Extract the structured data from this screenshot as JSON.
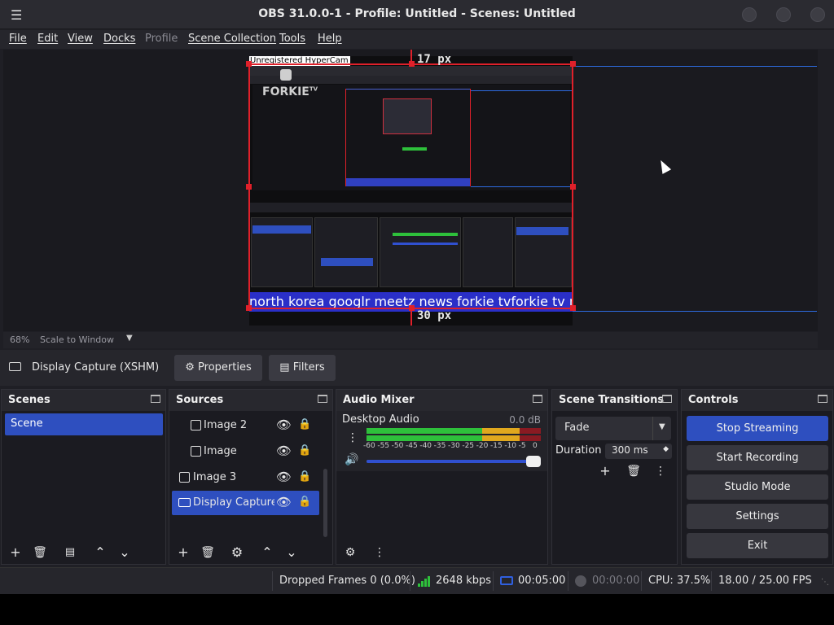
{
  "window": {
    "title": "OBS 31.0.0-1 - Profile: Untitled - Scenes: Untitled"
  },
  "menu": {
    "file": "File",
    "edit": "Edit",
    "view": "View",
    "docks": "Docks",
    "profile": "Profile",
    "scene_collection": "Scene Collection",
    "tools": "Tools",
    "help": "Help"
  },
  "preview": {
    "top_px_label": "17 px",
    "bottom_px_label": "30 px",
    "source_top_text": "Unregistered HyperCam 2",
    "logo_text": "FORKIE",
    "logo_sup": "TV",
    "ticker_text": "north korea googlr meetz news forkie tvforkie tv news br"
  },
  "zoom": {
    "percent": "68%",
    "mode": "Scale to Window"
  },
  "source_toolbar": {
    "selected_source": "Display Capture (XSHM)",
    "properties_label": "Properties",
    "filters_label": "Filters"
  },
  "scenes": {
    "title": "Scenes",
    "items": [
      "Scene"
    ]
  },
  "sources": {
    "title": "Sources",
    "items": [
      {
        "name": "Image 2",
        "icon": "image-icon"
      },
      {
        "name": "Image",
        "icon": "image-icon"
      },
      {
        "name": "Image 3",
        "icon": "image-icon"
      },
      {
        "name": "Display Capture (",
        "icon": "monitor-icon"
      }
    ]
  },
  "mixer": {
    "title": "Audio Mixer",
    "channel": "Desktop Audio",
    "level": "0.0 dB",
    "scale": [
      "-60",
      "-55",
      "-50",
      "-45",
      "-40",
      "-35",
      "-30",
      "-25",
      "-20",
      "-15",
      "-10",
      "-5",
      "0"
    ],
    "volume_fraction": 1.0
  },
  "transitions": {
    "title": "Scene Transitions",
    "selected": "Fade",
    "duration_label": "Duration",
    "duration_value": "300 ms"
  },
  "controls": {
    "title": "Controls",
    "stop_streaming": "Stop Streaming",
    "start_recording": "Start Recording",
    "studio_mode": "Studio Mode",
    "settings": "Settings",
    "exit": "Exit"
  },
  "status": {
    "dropped_frames": "Dropped Frames 0 (0.0%)",
    "bitrate": "2648 kbps",
    "stream_time": "00:05:00",
    "record_time": "00:00:00",
    "cpu": "CPU: 37.5%",
    "fps": "18.00 / 25.00 FPS"
  },
  "colors": {
    "accent": "#2e4fbf",
    "guide": "#2d6be0",
    "selection": "#e0202a",
    "meter_green": "#2ec03b",
    "meter_yellow": "#e0a81e",
    "meter_red": "#c02020"
  }
}
